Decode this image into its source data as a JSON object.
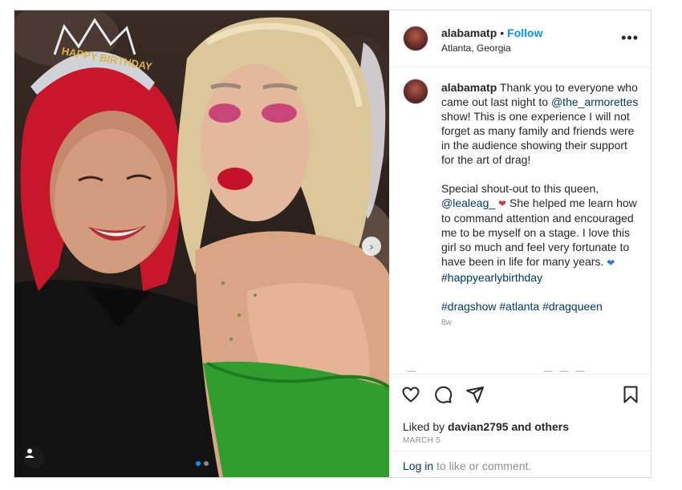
{
  "post": {
    "username": "alabamatp",
    "bullet": "•",
    "follow_label": "Follow",
    "location": "Atlanta, Georgia",
    "more_label": "•••",
    "caption": {
      "line1_text": "Thank you to everyone who came out last night to",
      "mention1": "@the_armorettes",
      "line1_tail": "show! This is one experience I will not forget as many family and friends were in the audience showing their support for the art of drag!",
      "para2_head": "Special shout-out to this queen,",
      "mention2": "@lealeag_",
      "para2_tail": "She helped me learn how to command attention and encouraged me to be myself on a stage. I love this girl so much and feel very fortunate to have been in life for many years.",
      "hashtag_birthday": "#happyearlybirthday",
      "hashtags": [
        "#dragshow",
        "#atlanta",
        "#dragqueen"
      ],
      "time": "8w"
    },
    "likes_prefix": "Liked by",
    "likes_user": "davian2795",
    "likes_suffix": "and others",
    "date": "MARCH 5",
    "login_link": "Log in",
    "login_tail": "to like or comment.",
    "icons": [
      "heart-icon",
      "comment-icon",
      "share-icon",
      "bookmark-icon",
      "user-tag-icon",
      "chevron-right-icon"
    ],
    "photo": {
      "tiara_text": "HAPPY BIRTHDAY"
    },
    "carousel": {
      "count": 2,
      "active": 0
    },
    "colors": {
      "accent": "#0095f6",
      "link": "#00376b",
      "muted": "#8e8e8e"
    }
  }
}
